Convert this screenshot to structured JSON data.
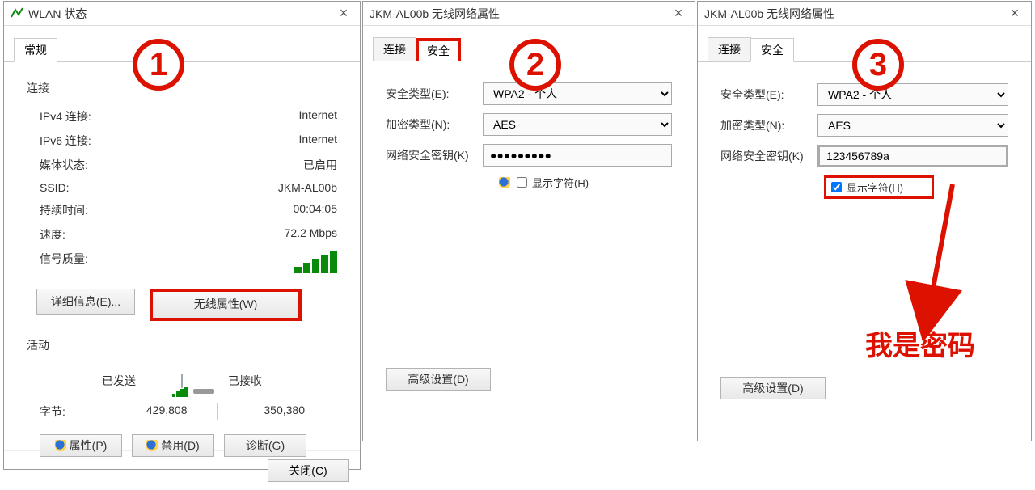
{
  "dialog1": {
    "title": "WLAN 状态",
    "tab": "常规",
    "connection_head": "连接",
    "rows": {
      "ipv4_k": "IPv4 连接:",
      "ipv4_v": "Internet",
      "ipv6_k": "IPv6 连接:",
      "ipv6_v": "Internet",
      "media_k": "媒体状态:",
      "media_v": "已启用",
      "ssid_k": "SSID:",
      "ssid_v": "JKM-AL00b",
      "duration_k": "持续时间:",
      "duration_v": "00:04:05",
      "speed_k": "速度:",
      "speed_v": "72.2 Mbps",
      "signal_k": "信号质量:"
    },
    "buttons": {
      "details": "详细信息(E)...",
      "wifiprop": "无线属性(W)"
    },
    "activity_head": "活动",
    "activity": {
      "sent": "已发送",
      "recv": "已接收",
      "bytes_k": "字节:",
      "sent_v": "429,808",
      "recv_v": "350,380"
    },
    "footer": {
      "prop": "属性(P)",
      "disable": "禁用(D)",
      "diag": "诊断(G)"
    },
    "close": "关闭(C)"
  },
  "dialog2": {
    "title": "JKM-AL00b 无线网络属性",
    "tabs": {
      "conn": "连接",
      "sec": "安全"
    },
    "form": {
      "sectype_l": "安全类型(E):",
      "sectype_v": "WPA2 - 个人",
      "enctype_l": "加密类型(N):",
      "enctype_v": "AES",
      "key_l": "网络安全密钥(K)",
      "key_v": "●●●●●●●●●",
      "show": "显示字符(H)"
    },
    "adv": "高级设置(D)"
  },
  "dialog3": {
    "title": "JKM-AL00b 无线网络属性",
    "tabs": {
      "conn": "连接",
      "sec": "安全"
    },
    "form": {
      "sectype_l": "安全类型(E):",
      "sectype_v": "WPA2 - 个人",
      "enctype_l": "加密类型(N):",
      "enctype_v": "AES",
      "key_l": "网络安全密钥(K)",
      "key_v": "123456789a",
      "show": "显示字符(H)"
    },
    "adv": "高级设置(D)"
  },
  "annotations": {
    "n1": "1",
    "n2": "2",
    "n3": "3",
    "pw_label": "我是密码"
  }
}
